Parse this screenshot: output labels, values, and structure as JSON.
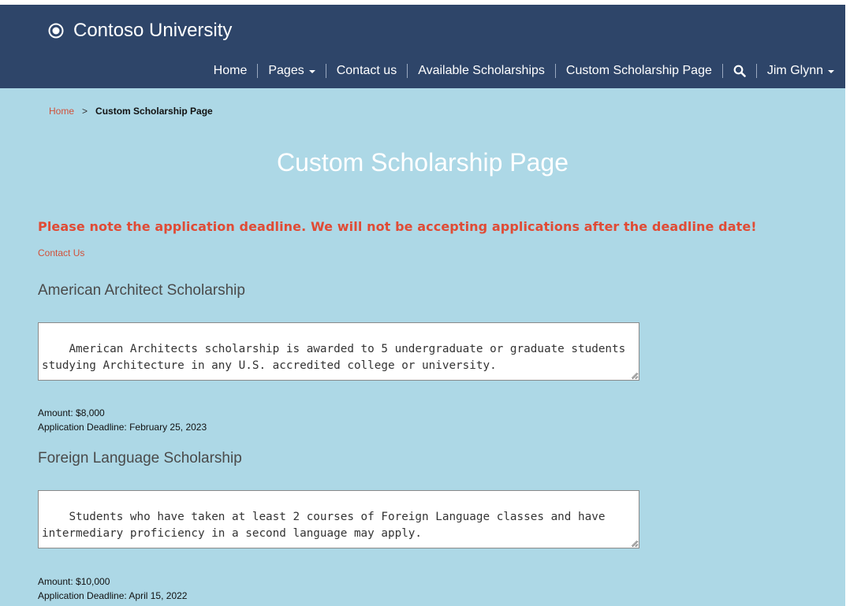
{
  "header": {
    "brand": "Contoso University",
    "logo_icon": "contoso-logo-icon",
    "nav": {
      "home": "Home",
      "pages": "Pages",
      "contact": "Contact us",
      "available": "Available Scholarships",
      "custom": "Custom Scholarship Page",
      "search_icon": "search-icon",
      "user": "Jim Glynn"
    }
  },
  "breadcrumb": {
    "home": "Home",
    "separator": ">",
    "current": "Custom Scholarship Page"
  },
  "page": {
    "title": "Custom Scholarship Page",
    "notice": "Please note the application deadline. We will not be accepting applications after the deadline date!",
    "contact_link": "Contact Us"
  },
  "scholarships": [
    {
      "name": "American Architect Scholarship",
      "description": "American Architects scholarship is awarded to 5 undergraduate or graduate students studying Architecture in any U.S. accredited college or university.",
      "amount": "Amount: $8,000",
      "deadline": "Application Deadline: February 25, 2023"
    },
    {
      "name": "Foreign Language Scholarship",
      "description": "Students who have taken at least 2 courses of Foreign Language classes and have intermediary proficiency in a second language may apply.",
      "amount": "Amount: $10,000",
      "deadline": "Application Deadline: April 15, 2022"
    }
  ],
  "colors": {
    "header_bg": "#2e4569",
    "page_bg": "#add8e6",
    "notice": "#e04b35",
    "link": "#d1513a"
  }
}
